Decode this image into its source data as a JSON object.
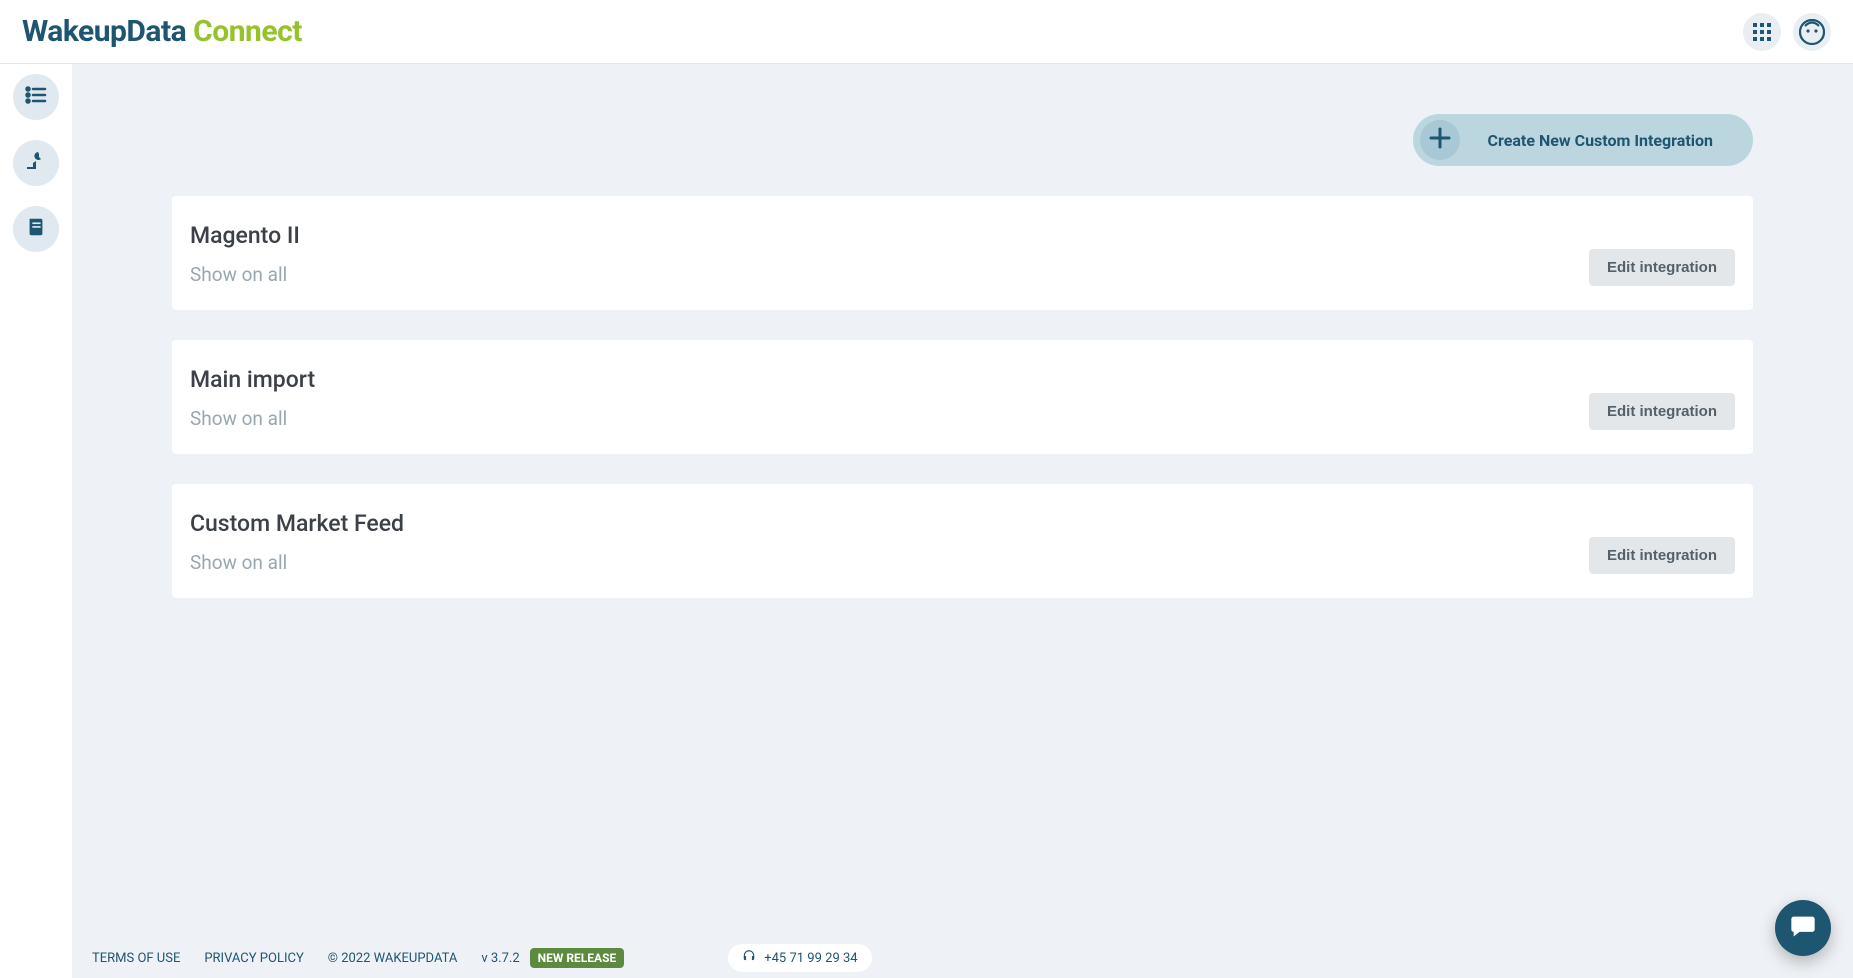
{
  "header": {
    "logo_word1": "WakeupData",
    "logo_word2": "Connect"
  },
  "actions": {
    "create_label": "Create New Custom Integration"
  },
  "integrations": [
    {
      "title": "Magento II",
      "subtitle": "Show on all",
      "edit": "Edit integration"
    },
    {
      "title": "Main import",
      "subtitle": "Show on all",
      "edit": "Edit integration"
    },
    {
      "title": "Custom Market Feed",
      "subtitle": "Show on all",
      "edit": "Edit integration"
    }
  ],
  "footer": {
    "terms": "TERMS OF USE",
    "privacy": "PRIVACY POLICY",
    "copyright": "© 2022 WAKEUPDATA",
    "version": "v 3.7.2",
    "badge": "NEW RELEASE",
    "phone": "+45 71 99 29 34"
  }
}
